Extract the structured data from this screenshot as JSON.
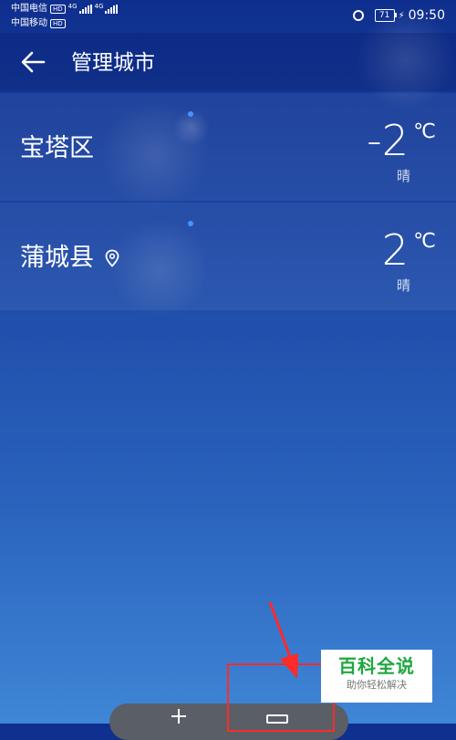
{
  "status_bar": {
    "carrier1": "中国电信",
    "carrier2": "中国移动",
    "hd": "HD",
    "network": "4G",
    "battery": "71",
    "time": "09:50"
  },
  "header": {
    "title": "管理城市",
    "back_icon": "back-arrow-icon"
  },
  "cities": [
    {
      "name": "宝塔区",
      "temp": "-2",
      "unit": "℃",
      "condition": "晴"
    },
    {
      "name": "蒲城县",
      "temp": "2",
      "unit": "℃",
      "condition": "晴",
      "location_icon": "location-pin-icon"
    }
  ],
  "watermark": {
    "title": "百科全说",
    "subtitle": "助你轻松解决"
  },
  "colors": {
    "highlight": "#ff2a2a",
    "watermark_green": "#1fa73f"
  }
}
